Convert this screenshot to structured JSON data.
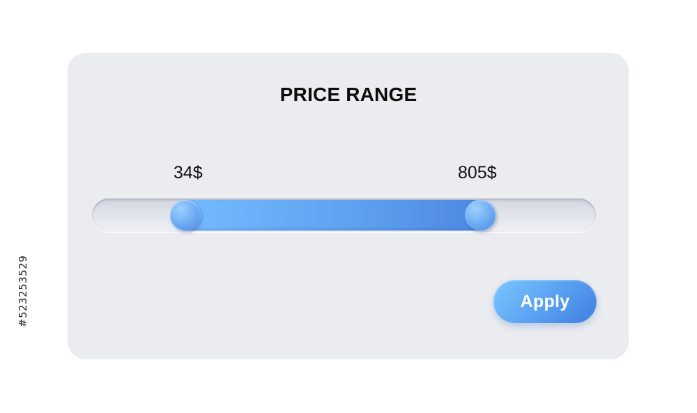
{
  "card": {
    "title": "PRICE RANGE"
  },
  "slider": {
    "min_label": "34$",
    "max_label": "805$",
    "low_value": 34,
    "high_value": 805,
    "low_fraction": 0.185,
    "high_fraction": 0.77
  },
  "actions": {
    "apply_label": "Apply"
  },
  "watermark": {
    "stock_id": "#523253529"
  },
  "colors": {
    "card_background": "#ebecf0",
    "accent": "#5fa2f0",
    "title_text": "#0d0d0d"
  }
}
